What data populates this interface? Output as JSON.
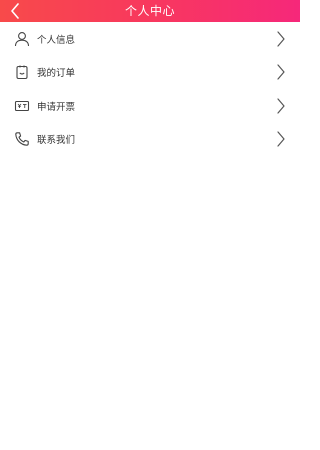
{
  "header": {
    "title": "个人中心",
    "background": "#f63d62"
  },
  "menu": {
    "items": [
      {
        "id": "profile",
        "label": "个人信息",
        "icon": "user-icon"
      },
      {
        "id": "orders",
        "label": "我的订单",
        "icon": "order-icon"
      },
      {
        "id": "invoice",
        "label": "申请开票",
        "icon": "invoice-icon"
      },
      {
        "id": "contact",
        "label": "联系我们",
        "icon": "phone-icon"
      }
    ]
  },
  "colors": {
    "text": "#333333",
    "icon": "#444444",
    "chevron": "#555555"
  }
}
